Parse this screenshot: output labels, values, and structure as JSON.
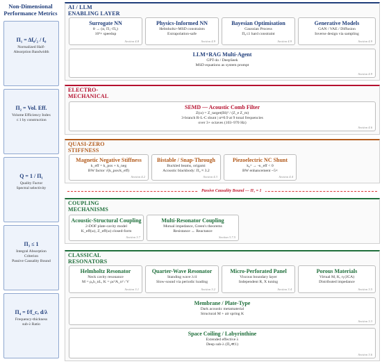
{
  "sidebar": {
    "title_line1": "Non-Dimensional",
    "title_line2": "Performance Metrics",
    "metrics": [
      {
        "formula": "Π₁ = Δf₀/₂ / f₀",
        "desc1": "Normalized Half-",
        "desc2": "Absorption Bandwidth",
        "desc3": ""
      },
      {
        "formula": "Π₂ = Vol. Eff.",
        "desc1": "Volume Efficiency Index",
        "desc2": "≤ 1 by construction",
        "desc3": ""
      },
      {
        "formula": "Q = 1 / Π₁",
        "desc1": "Quality Factor",
        "desc2": "Spectral selectivity",
        "desc3": ""
      },
      {
        "formula": "Π₃ ≤ 1",
        "desc1": "Integral Absorption",
        "desc2": "Criterion",
        "desc3": "Passive Causality Bound"
      },
      {
        "formula": "Π₄ = f/f_c, d/λ",
        "desc1": "Frequency-thickness",
        "desc2": "sub-λ Ratio",
        "desc3": ""
      }
    ]
  },
  "layers": {
    "ai": {
      "title_line1": "AI / LLM",
      "title_line2": "ENABLING LAYER",
      "cards": [
        {
          "title": "Surrogate NN",
          "line1": "θ → (α, Π₁–Π₅)",
          "line2": "10³× speedup",
          "section": "Section 4.8"
        },
        {
          "title": "Physics-Informed NN",
          "line1": "Helmholtz+MSD constraints",
          "line2": "Extrapolation-safe",
          "section": "Section 4.9"
        },
        {
          "title": "Bayesian Optimisation",
          "line1": "Gaussian Process",
          "line2": "Π₃≤1 hard constraint",
          "section": "Section 4.9"
        },
        {
          "title": "Generative Models",
          "line1": "GAN / VAE / Diffusion",
          "line2": "Inverse design via sampling",
          "section": "Section 4.9"
        },
        {
          "title": "LLM+RAG Multi-Agent",
          "line1": "GPT-4o / DeepSeek",
          "line2": "MSD equations as system prompt",
          "section": "Section 4.9"
        }
      ]
    },
    "em": {
      "title_line1": "ELECTRO-",
      "title_line2": "MECHANICAL",
      "cards": [
        {
          "title": "SEMD — Acoustic Comb Filter",
          "line1": "Z(ω) = Z_target(Bl)² / (Z_e Z_m)",
          "line2": "3-branch R-L-C shunt | α≈0.9 at 9 tonal frequencies",
          "line3": "over 3+ octaves (103–970 Hz)",
          "section": "Section 4.6"
        }
      ]
    },
    "qz": {
      "title_line1": "QUASI-ZERO",
      "title_line2": "STIFFNESS",
      "cards": [
        {
          "title": "Magnetic Negative Stiffness",
          "line1": "k_eff = k_pos + k_neg",
          "line2": "BW factor √(k_pos/k_eff)",
          "section": "Section 4.2"
        },
        {
          "title": "Bistable / Snap-Through",
          "line1": "Buckled beams, origami",
          "line2": "Acoustic blackbody: Π₂ ≈ 3.2",
          "section": "Section 4.3"
        },
        {
          "title": "Piezoelectric NC Shunt",
          "line1": "k₀ᶜᶦ → -κ_eff < 0",
          "line2": "BW enhancement ~5×",
          "section": "Section 4.4"
        }
      ]
    },
    "bound": {
      "label": "Passive Causality Bound — Π₃ = 1"
    },
    "cm": {
      "title_line1": "COUPLING",
      "title_line2": "MECHANISMS",
      "cards": [
        {
          "title": "Acoustic-Structural Coupling",
          "line1": "2-DOF plate-cavity model",
          "line2": "K_eff(ω), Z_eff(ω) closed-form",
          "section": "Section 3.7"
        },
        {
          "title": "Multi-Resonator Coupling",
          "line1": "Mutual impedance, Green's theorems",
          "line2": "Resistance ↔ Reactance",
          "section": "Section 3.7.5"
        }
      ]
    },
    "cr": {
      "title_line1": "CLASSICAL",
      "title_line2": "RESONATORS",
      "cards": [
        {
          "title": "Helmholtz Resonator",
          "line1": "Neck cavity resonance",
          "line2": "M = ρ₀h_nL, K = ρc²A_n² / V",
          "section": "Section 3.1"
        },
        {
          "title": "Quarter-Wave Resonator",
          "line1": "Standing wave λ/4",
          "line2": "Slow-sound via periodic loading",
          "section": "Section 3.2"
        },
        {
          "title": "Micro-Perforated Panel",
          "line1": "Viscous boundary layer",
          "line2": "Independent R, X tuning",
          "section": "Section 3.4"
        },
        {
          "title": "Porous Materials",
          "line1": "Virtual M, K, η (JCA)",
          "line2": "Distributed impedance",
          "section": "Section 3.5"
        },
        {
          "title": "Membrane / Plate-Type",
          "line1": "Dark acoustic metamaterial",
          "line2": "Structural M + air spring K",
          "section": "Section 3.3"
        },
        {
          "title": "Space Coiling / Labyrinthine",
          "line1": "Extended effective λ",
          "line2": "Deep sub-λ (Π₄≪1)",
          "section": "Section 3.6"
        }
      ]
    }
  }
}
